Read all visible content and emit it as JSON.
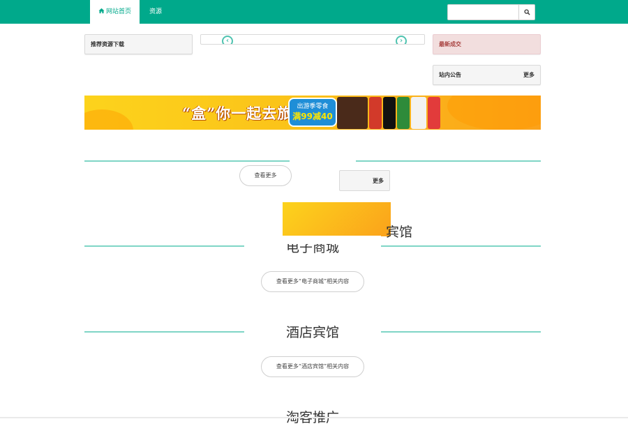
{
  "nav": {
    "home_label": "网站首页",
    "resources_label": "资源",
    "search_placeholder": ""
  },
  "panels": {
    "recommended_title": "推荐资源下载",
    "latest_deals_title": "最新成交",
    "notice_title": "站内公告",
    "notice_more": "更多"
  },
  "banner": {
    "slogan": "“盒”你一起去旅行",
    "promo_line1": "出游季零食",
    "promo_line2": "满99减40"
  },
  "overlay": {
    "view_more": "查看更多",
    "more": "更多",
    "partial_title": "宾馆"
  },
  "sections": [
    {
      "title": "电子商城",
      "button": "查看更多“电子商城”相关内容"
    },
    {
      "title": "酒店宾馆",
      "button": "查看更多“酒店宾馆”相关内容"
    },
    {
      "title": "淘客推广",
      "button": ""
    }
  ],
  "colors": {
    "brand": "#00a98b",
    "divider": "#7fd5c6",
    "deal_panel_bg": "#f2dede",
    "deal_panel_text": "#a94442"
  },
  "icons": [
    "home-icon",
    "search-icon",
    "chevron-left-icon",
    "chevron-right-icon"
  ]
}
